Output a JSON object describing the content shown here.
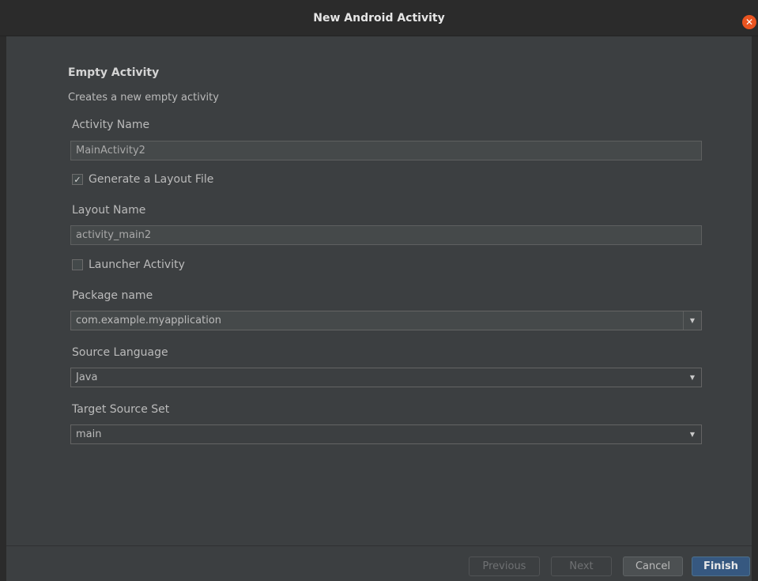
{
  "window": {
    "title": "New Android Activity"
  },
  "form": {
    "heading": "Empty Activity",
    "description": "Creates a new empty activity",
    "activity_name": {
      "label": "Activity Name",
      "value": "MainActivity2"
    },
    "generate_layout": {
      "label": "Generate a Layout File",
      "checked": true,
      "check_glyph": "✓"
    },
    "layout_name": {
      "label": "Layout Name",
      "value": "activity_main2"
    },
    "launcher_activity": {
      "label": "Launcher Activity",
      "checked": false
    },
    "package_name": {
      "label": "Package name",
      "value": "com.example.myapplication"
    },
    "source_language": {
      "label": "Source Language",
      "value": "Java"
    },
    "target_source_set": {
      "label": "Target Source Set",
      "value": "main"
    }
  },
  "buttons": {
    "previous": "Previous",
    "next": "Next",
    "cancel": "Cancel",
    "finish": "Finish"
  },
  "icons": {
    "close": "✕",
    "dropdown": "▼"
  },
  "colors": {
    "accent": "#365880",
    "close_button": "#e95420",
    "background": "#3c3f41"
  }
}
